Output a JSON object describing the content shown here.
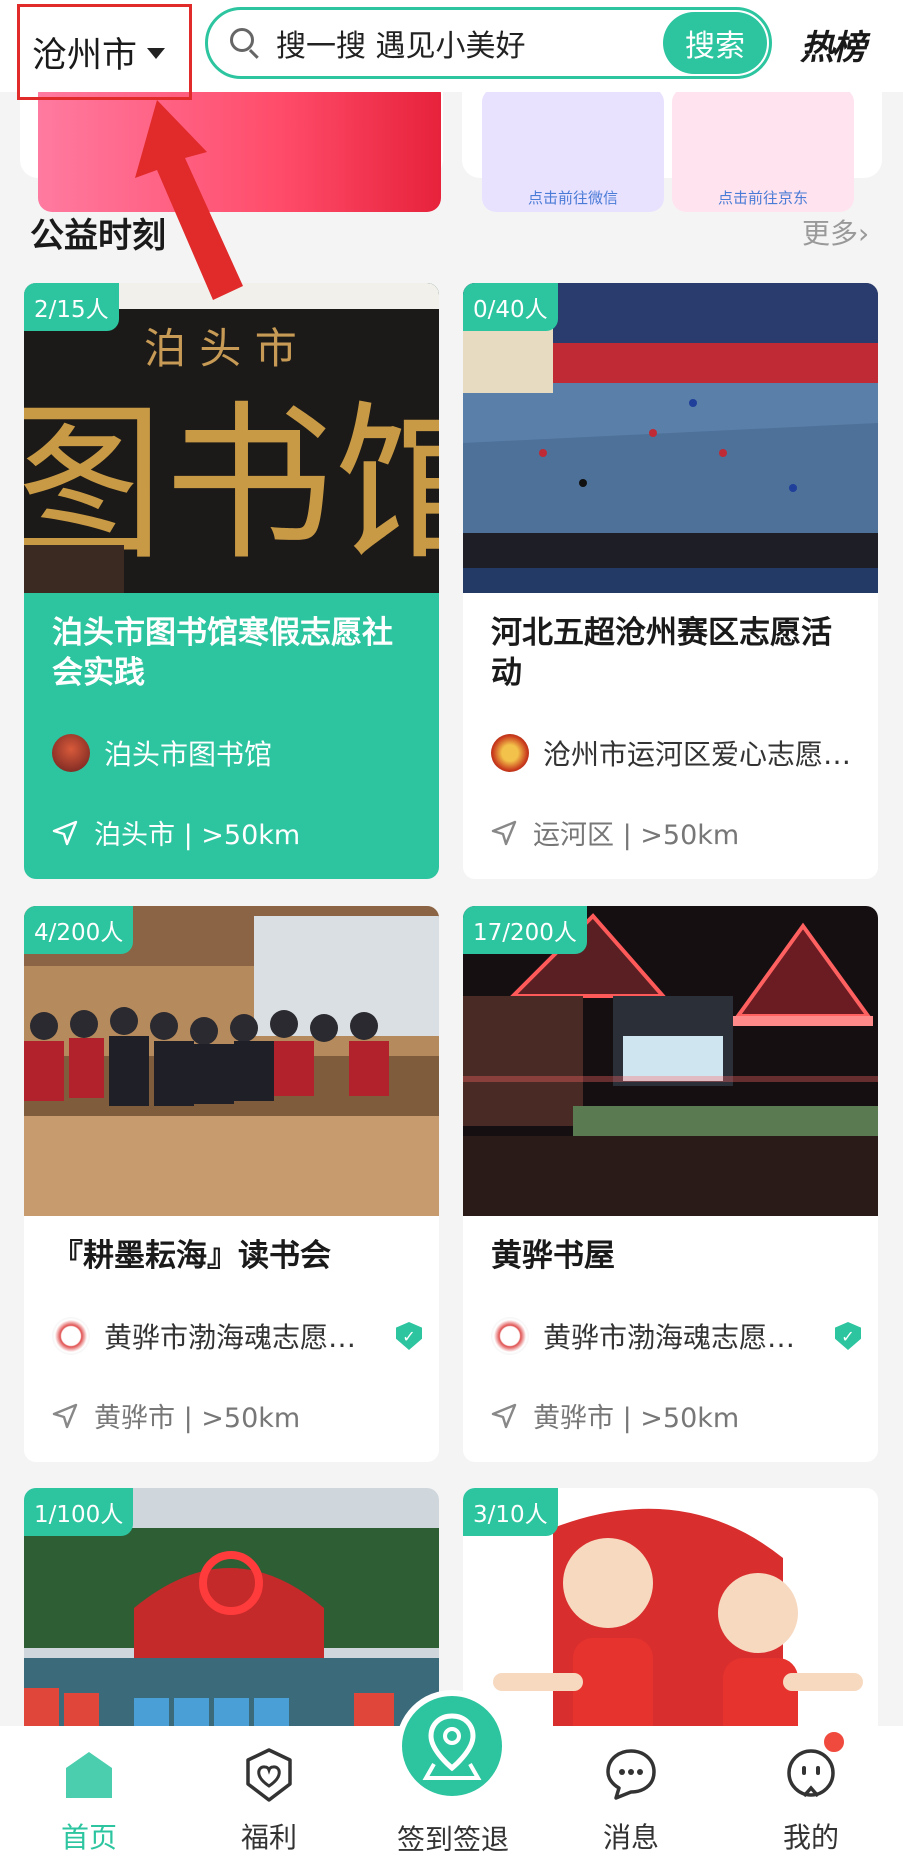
{
  "header": {
    "city": "沧州市",
    "search_placeholder": "搜一搜 遇见小美好",
    "search_button": "搜索",
    "hot_label": "热榜"
  },
  "banner": {
    "mini_a_caption": "点击前往微信",
    "mini_b_caption": "点击前往京东"
  },
  "section": {
    "title": "公益时刻",
    "more": "更多›"
  },
  "cards": [
    {
      "count": "2/15人",
      "title": "泊头市图书馆寒假志愿社会实践",
      "org": "泊头市图书馆",
      "location": "泊头市 | >50km",
      "verified": false
    },
    {
      "count": "0/40人",
      "title": "河北五超沧州赛区志愿活动",
      "org": "沧州市运河区爱心志愿…",
      "location": "运河区 | >50km",
      "verified": false
    },
    {
      "count": "4/200人",
      "title": "『耕墨耘海』读书会",
      "org": "黄骅市渤海魂志愿…",
      "location": "黄骅市 | >50km",
      "verified": true
    },
    {
      "count": "17/200人",
      "title": "黄骅书屋",
      "org": "黄骅市渤海魂志愿…",
      "location": "黄骅市 | >50km",
      "verified": true
    },
    {
      "count": "1/100人",
      "title": "",
      "org": "",
      "location": "",
      "verified": false
    },
    {
      "count": "3/10人",
      "title": "",
      "org": "",
      "location": "",
      "verified": false
    }
  ],
  "tabbar": {
    "home": "首页",
    "welfare": "福利",
    "checkin": "签到签退",
    "messages": "消息",
    "mine": "我的"
  },
  "colors": {
    "accent": "#2cc5a0",
    "annotation": "#e12a2a",
    "badge": "#f04a3e"
  }
}
